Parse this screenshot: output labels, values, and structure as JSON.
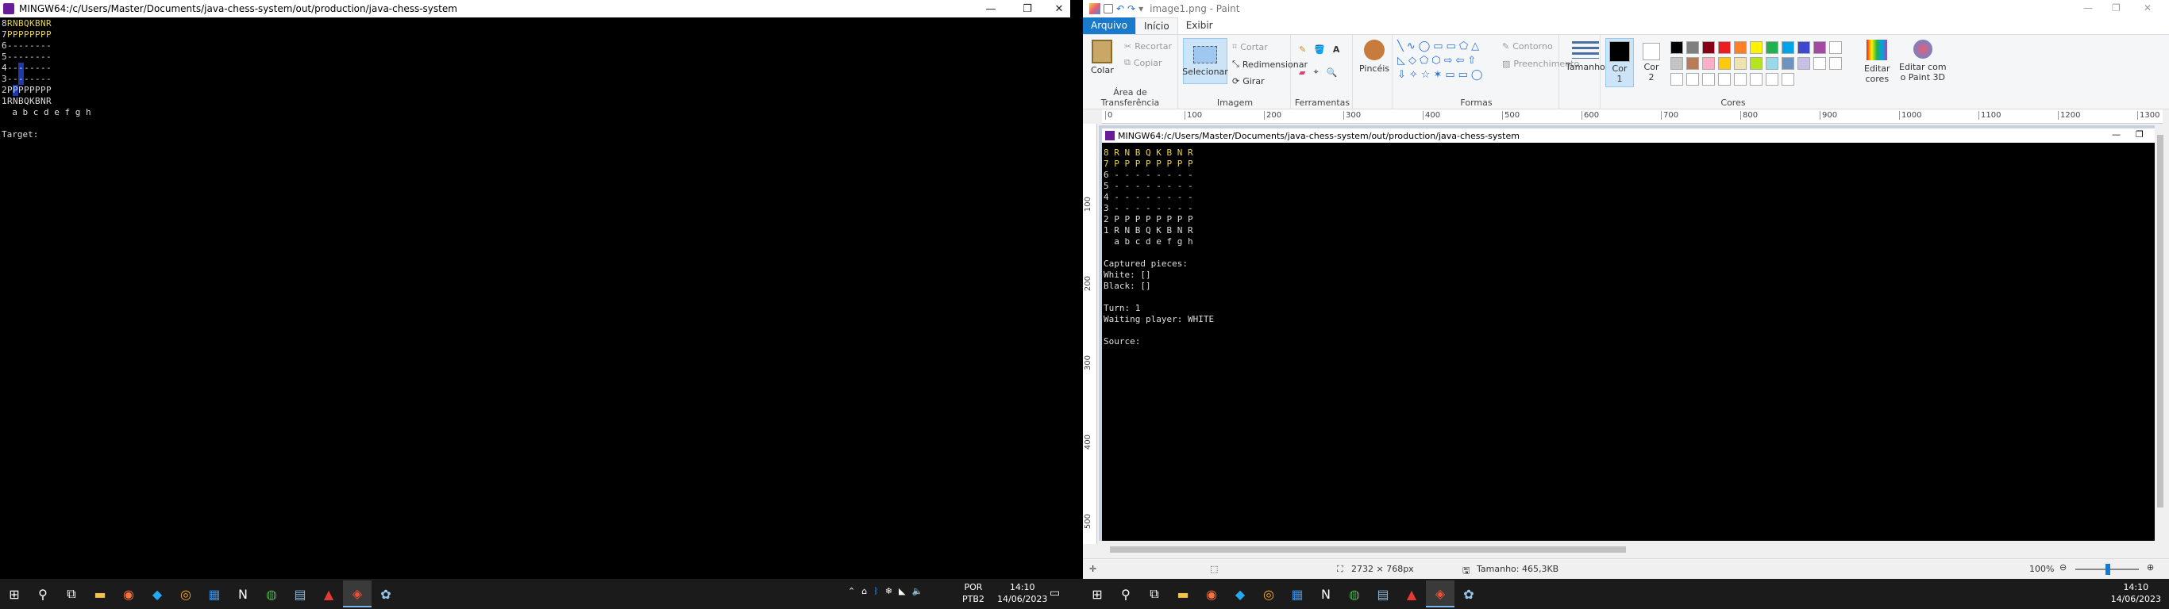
{
  "terminal": {
    "title": "MINGW64:/c/Users/Master/Documents/java-chess-system/out/production/java-chess-system",
    "board_rows": [
      {
        "rank": "8",
        "cells": [
          "R",
          "N",
          "B",
          "Q",
          "K",
          "B",
          "N",
          "R"
        ],
        "color": "yellow"
      },
      {
        "rank": "7",
        "cells": [
          "P",
          "P",
          "P",
          "P",
          "P",
          "P",
          "P",
          "P"
        ],
        "color": "yellow"
      },
      {
        "rank": "6",
        "cells": [
          "-",
          "-",
          "-",
          "-",
          "-",
          "-",
          "-",
          "-"
        ]
      },
      {
        "rank": "5",
        "cells": [
          "-",
          "-",
          "-",
          "-",
          "-",
          "-",
          "-",
          "-"
        ]
      },
      {
        "rank": "4",
        "cells": [
          "-",
          "-",
          "-",
          "-",
          "-",
          "-",
          "-",
          "-"
        ],
        "hl": [
          2
        ]
      },
      {
        "rank": "3",
        "cells": [
          "-",
          "-",
          "-",
          "-",
          "-",
          "-",
          "-",
          "-"
        ],
        "hl": [
          2
        ]
      },
      {
        "rank": "2",
        "cells": [
          "P",
          "P",
          "P",
          "P",
          "P",
          "P",
          "P",
          "P"
        ],
        "hl": [
          1
        ]
      },
      {
        "rank": "1",
        "cells": [
          "R",
          "N",
          "B",
          "Q",
          "K",
          "B",
          "N",
          "R"
        ]
      }
    ],
    "files": "  a b c d e f g h",
    "prompt": "Target:"
  },
  "paint": {
    "window_title": "image1.png - Paint",
    "tabs": [
      "Arquivo",
      "Início",
      "Exibir"
    ],
    "groups": {
      "clipboard": {
        "label": "Área de Transferência",
        "paste": "Colar",
        "cut": "Recortar",
        "copy": "Copiar"
      },
      "image": {
        "label": "Imagem",
        "select": "Selecionar",
        "crop": "Cortar",
        "resize": "Redimensionar",
        "rotate": "Girar"
      },
      "tools": {
        "label": "Ferramentas"
      },
      "brushes": {
        "label": "Pincéis"
      },
      "shapes": {
        "label": "Formas",
        "outline": "Contorno",
        "fill": "Preenchimento"
      },
      "size": {
        "label": "Tamanho"
      },
      "colors": {
        "label": "Cores",
        "color1": "Cor\n1",
        "color2": "Cor\n2",
        "edit": "Editar\ncores",
        "paint3d": "Editar com\no Paint 3D"
      }
    },
    "palette": [
      "#000000",
      "#7f7f7f",
      "#880015",
      "#ed1c24",
      "#ff7f27",
      "#fff200",
      "#22b14c",
      "#00a2e8",
      "#3f48cc",
      "#a349a4",
      "#ffffff",
      "#c3c3c3",
      "#b97a57",
      "#ffaec9",
      "#ffc90e",
      "#efe4b0",
      "#b5e61d",
      "#99d9ea",
      "#7092be",
      "#c8bfe7"
    ],
    "ruler_h": [
      "0",
      "100",
      "200",
      "300",
      "400",
      "500",
      "600",
      "700",
      "800",
      "900",
      "1000",
      "1100",
      "1200",
      "1300"
    ],
    "ruler_v": [
      "100",
      "200",
      "300",
      "400",
      "500"
    ],
    "inner": {
      "title": "MINGW64:/c/Users/Master/Documents/java-chess-system/out/production/java-chess-system",
      "lines": [
        {
          "text": "8 R N B Q K B N R",
          "color": "yellow"
        },
        {
          "text": "7 P P P P P P P P",
          "color": "yellow"
        },
        {
          "text": "6 - - - - - - - -"
        },
        {
          "text": "5 - - - - - - - -"
        },
        {
          "text": "4 - - - - - - - -"
        },
        {
          "text": "3 - - - - - - - -"
        },
        {
          "text": "2 P P P P P P P P"
        },
        {
          "text": "1 R N B Q K B N R"
        },
        {
          "text": "  a b c d e f g h"
        },
        {
          "text": ""
        },
        {
          "text": "Captured pieces:"
        },
        {
          "text": "White: []"
        },
        {
          "text": "Black: []",
          "color": "yellow-bracket"
        },
        {
          "text": ""
        },
        {
          "text": "Turn: 1"
        },
        {
          "text": "Waiting player: WHITE"
        },
        {
          "text": ""
        },
        {
          "text": "Source:"
        }
      ]
    },
    "status": {
      "dimensions": "2732 × 768px",
      "size": "Tamanho: 465,3KB",
      "zoom": "100%"
    }
  },
  "taskbar_left": {
    "lang": "POR\nPTB2",
    "time": "14:10",
    "date": "14/06/2023"
  },
  "taskbar_right": {
    "time": "14:10",
    "date": "14/06/2023"
  }
}
